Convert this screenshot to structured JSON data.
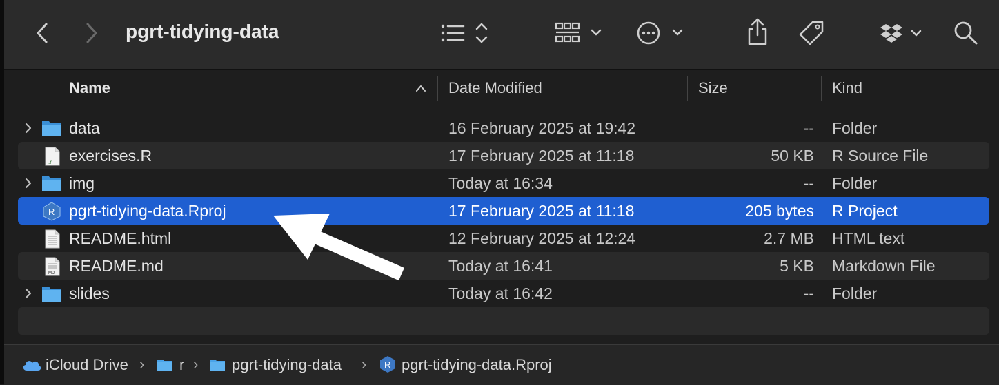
{
  "window": {
    "title": "pgrt-tidying-data"
  },
  "toolbar": {
    "icons": [
      "back-icon",
      "forward-icon",
      "list-view-icon",
      "group-icon",
      "more-actions-icon",
      "share-icon",
      "tag-icon",
      "dropbox-icon",
      "search-icon"
    ]
  },
  "columns": {
    "name": "Name",
    "date": "Date Modified",
    "size": "Size",
    "kind": "Kind"
  },
  "files": [
    {
      "name": "data",
      "date": "16 February 2025 at 19:42",
      "size": "--",
      "kind": "Folder",
      "type": "folder"
    },
    {
      "name": "exercises.R",
      "date": "17 February 2025 at 11:18",
      "size": "50 KB",
      "kind": "R Source File",
      "type": "r-file"
    },
    {
      "name": "img",
      "date": "Today at 16:34",
      "size": "--",
      "kind": "Folder",
      "type": "folder"
    },
    {
      "name": "pgrt-tidying-data.Rproj",
      "date": "17 February 2025 at 11:18",
      "size": "205 bytes",
      "kind": "R Project",
      "type": "rproj",
      "selected": true
    },
    {
      "name": "README.html",
      "date": "12 February 2025 at 12:24",
      "size": "2.7 MB",
      "kind": "HTML text",
      "type": "doc"
    },
    {
      "name": "README.md",
      "date": "Today at 16:41",
      "size": "5 KB",
      "kind": "Markdown File",
      "type": "md"
    },
    {
      "name": "slides",
      "date": "Today at 16:42",
      "size": "--",
      "kind": "Folder",
      "type": "folder"
    }
  ],
  "pathbar": {
    "icloud": "iCloud Drive",
    "r": "r",
    "project": "pgrt-tidying-data",
    "file": "pgrt-tidying-data.Rproj"
  },
  "colors": {
    "selection": "#1f5fd1",
    "folder": "#4aa3e8",
    "background": "#1e1e1e"
  }
}
